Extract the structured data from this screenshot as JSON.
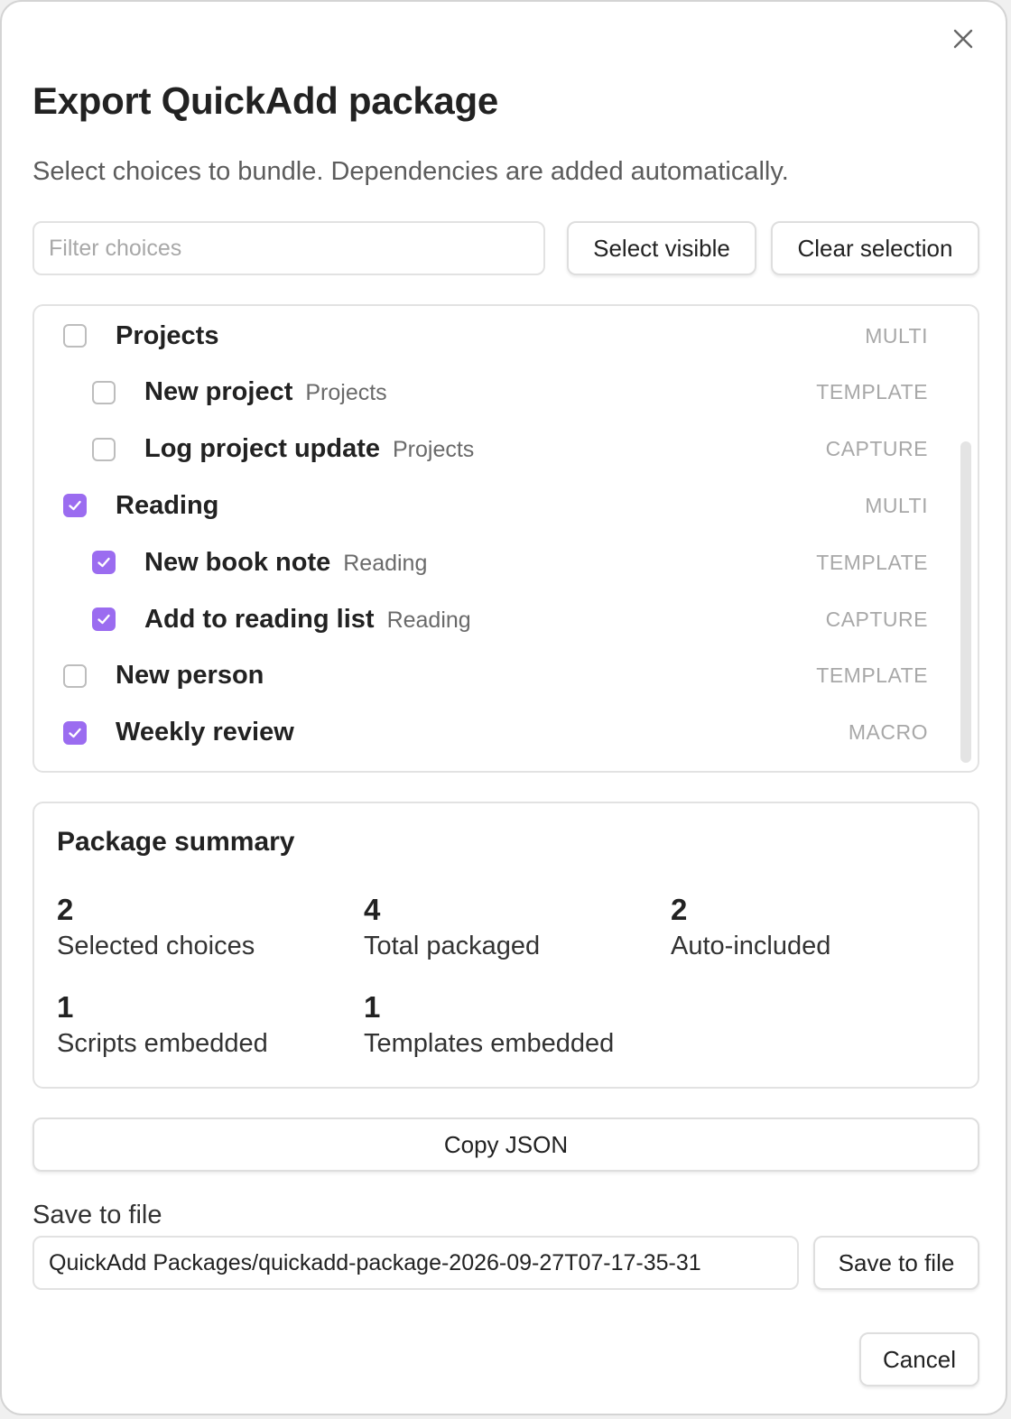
{
  "dialog": {
    "title": "Export QuickAdd package",
    "subtitle": "Select choices to bundle. Dependencies are added automatically."
  },
  "filter": {
    "placeholder": "Filter choices",
    "value": ""
  },
  "toolbar": {
    "select_visible_label": "Select visible",
    "clear_selection_label": "Clear selection"
  },
  "choices": [
    {
      "label": "Projects",
      "path": "",
      "type": "MULTI",
      "checked": false,
      "indent": 0
    },
    {
      "label": "New project",
      "path": "Projects",
      "type": "TEMPLATE",
      "checked": false,
      "indent": 1
    },
    {
      "label": "Log project update",
      "path": "Projects",
      "type": "CAPTURE",
      "checked": false,
      "indent": 1
    },
    {
      "label": "Reading",
      "path": "",
      "type": "MULTI",
      "checked": true,
      "indent": 0
    },
    {
      "label": "New book note",
      "path": "Reading",
      "type": "TEMPLATE",
      "checked": true,
      "indent": 1
    },
    {
      "label": "Add to reading list",
      "path": "Reading",
      "type": "CAPTURE",
      "checked": true,
      "indent": 1
    },
    {
      "label": "New person",
      "path": "",
      "type": "TEMPLATE",
      "checked": false,
      "indent": 0
    },
    {
      "label": "Weekly review",
      "path": "",
      "type": "MACRO",
      "checked": true,
      "indent": 0
    }
  ],
  "summary": {
    "title": "Package summary",
    "stats": [
      {
        "value": "2",
        "label": "Selected choices"
      },
      {
        "value": "4",
        "label": "Total packaged"
      },
      {
        "value": "2",
        "label": "Auto-included"
      },
      {
        "value": "1",
        "label": "Scripts embedded"
      },
      {
        "value": "1",
        "label": "Templates embedded"
      }
    ]
  },
  "actions": {
    "copy_json_label": "Copy JSON",
    "save_section_label": "Save to file",
    "save_path_value": "QuickAdd Packages/quickadd-package-2026-09-27T07-17-35-31",
    "save_button_label": "Save to file",
    "cancel_label": "Cancel"
  },
  "colors": {
    "accent": "#9b6cf0",
    "border": "#e2e2e2",
    "muted_text": "#a8a8a8"
  },
  "icons": {
    "close": "close-icon",
    "check": "check-icon"
  }
}
